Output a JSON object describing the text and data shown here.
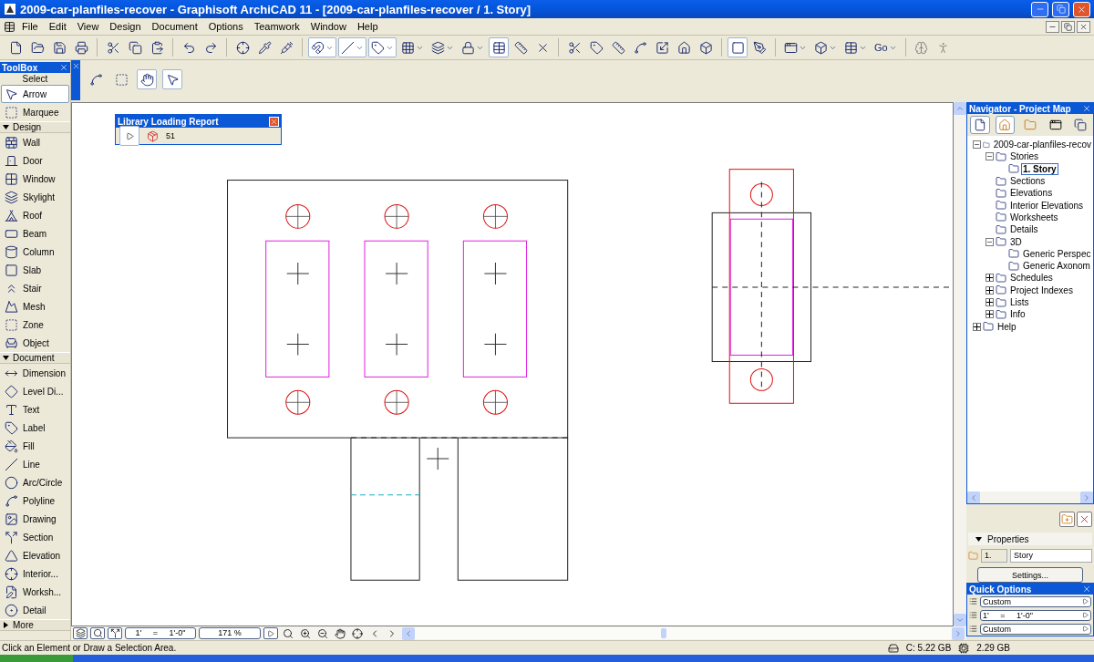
{
  "window": {
    "title": "2009-car-planfiles-recover - Graphisoft ArchiCAD 11 - [2009-car-planfiles-recover / 1. Story]"
  },
  "menu": [
    "File",
    "Edit",
    "View",
    "Design",
    "Document",
    "Options",
    "Teamwork",
    "Window",
    "Help"
  ],
  "toolbar": {
    "go_label": "Go"
  },
  "toolbox": {
    "title": "ToolBox",
    "select_label": "Select",
    "select_tools": [
      {
        "label": "Arrow",
        "selected": true
      },
      {
        "label": "Marquee",
        "selected": false
      }
    ],
    "groups": [
      {
        "label": "Design",
        "expanded": true,
        "tools": [
          "Wall",
          "Door",
          "Window",
          "Skylight",
          "Roof",
          "Beam",
          "Column",
          "Slab",
          "Stair",
          "Mesh",
          "Zone",
          "Object"
        ]
      },
      {
        "label": "Document",
        "expanded": true,
        "tools": [
          "Dimension",
          "Level Di...",
          "Text",
          "Label",
          "Fill",
          "Line",
          "Arc/Circle",
          "Polyline",
          "Drawing",
          "Section",
          "Elevation",
          "Interior...",
          "Worksh...",
          "Detail"
        ]
      },
      {
        "label": "More",
        "expanded": false
      }
    ]
  },
  "library_report": {
    "title": "Library Loading Report",
    "count": "51"
  },
  "canvas_nav": {
    "scale": "1'     =     1'-0\"",
    "zoom": "171 %"
  },
  "navigator": {
    "title": "Navigator - Project Map",
    "tree": [
      {
        "label": "2009-car-planfiles-recov",
        "expanded": true,
        "selected": false,
        "children": [
          {
            "label": "Stories",
            "expanded": true,
            "selected": false,
            "children": [
              {
                "label": "1. Story",
                "selected": true
              }
            ]
          },
          {
            "label": "Sections",
            "selected": false
          },
          {
            "label": "Elevations",
            "selected": false
          },
          {
            "label": "Interior Elevations",
            "selected": false
          },
          {
            "label": "Worksheets",
            "selected": false
          },
          {
            "label": "Details",
            "selected": false
          },
          {
            "label": "3D",
            "expanded": true,
            "selected": false,
            "children": [
              {
                "label": "Generic Perspec",
                "selected": false
              },
              {
                "label": "Generic Axonom",
                "selected": false
              }
            ]
          },
          {
            "label": "Schedules",
            "expanded": false,
            "selected": false
          },
          {
            "label": "Project Indexes",
            "expanded": false,
            "selected": false
          },
          {
            "label": "Lists",
            "expanded": false,
            "selected": false
          },
          {
            "label": "Info",
            "expanded": false,
            "selected": false
          }
        ]
      },
      {
        "label": "Help",
        "expanded": false,
        "selected": false
      }
    ]
  },
  "properties": {
    "label": "Properties",
    "id": "1.",
    "name": "Story",
    "button": "Settings..."
  },
  "quick_options": {
    "title": "Quick Options",
    "rows": [
      "Custom",
      "1'     =     1'-0\"",
      "Custom"
    ]
  },
  "status_bar": {
    "message": "Click an Element or Draw a Selection Area.",
    "disk": "C: 5.22 GB",
    "memory": "2.29 GB"
  }
}
